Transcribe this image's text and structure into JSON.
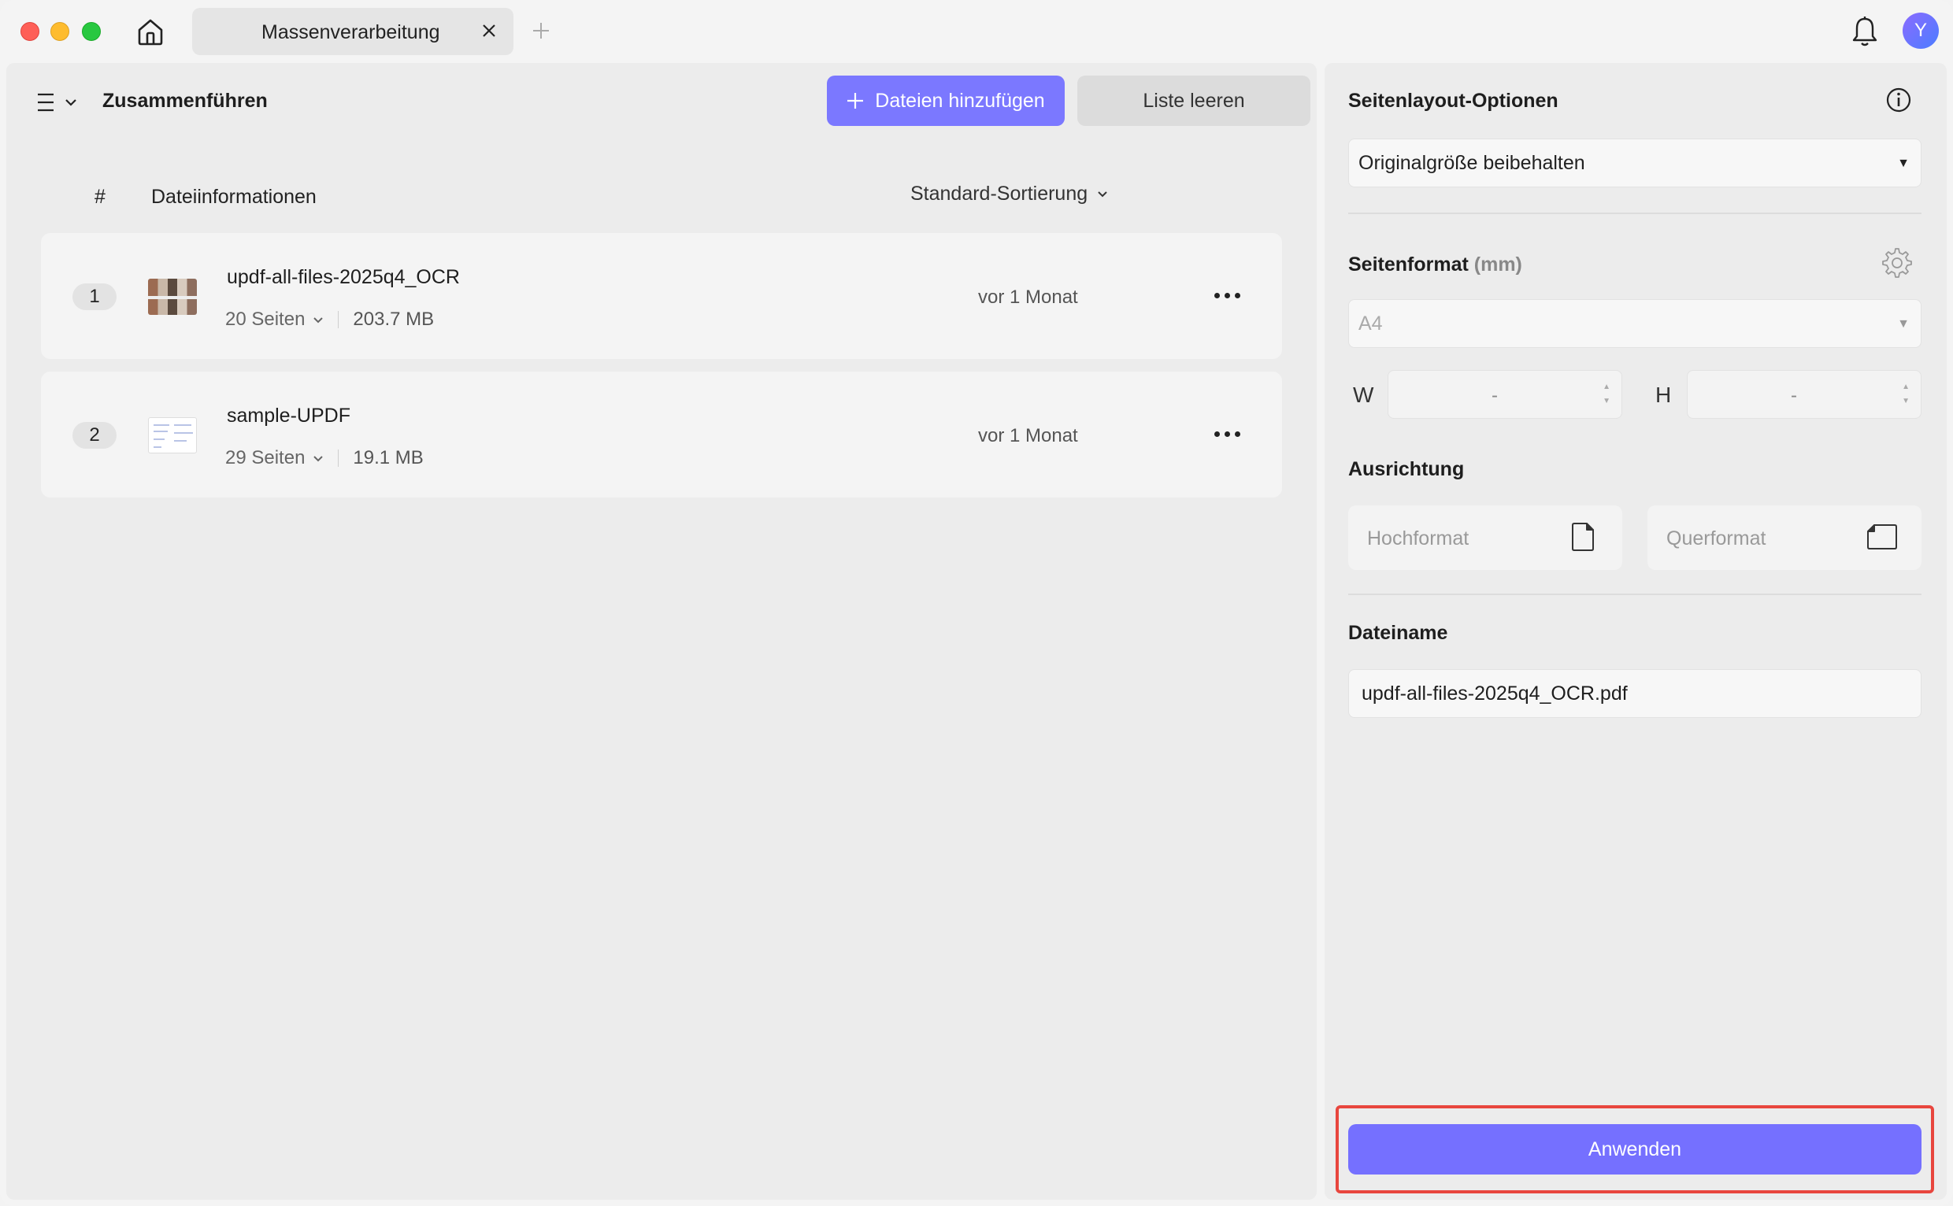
{
  "titlebar": {
    "tab_label": "Massenverarbeitung",
    "avatar_initial": "Y"
  },
  "toolbar": {
    "section_title": "Zusammenführen",
    "add_files_label": "Dateien hinzufügen",
    "clear_list_label": "Liste leeren"
  },
  "table": {
    "col_hash": "#",
    "col_info": "Dateiinformationen",
    "sort_label": "Standard-Sortierung",
    "rows": [
      {
        "num": "1",
        "name": "updf-all-files-2025q4_OCR",
        "pages": "20 Seiten",
        "size": "203.7 MB",
        "date": "vor 1 Monat"
      },
      {
        "num": "2",
        "name": "sample-UPDF",
        "pages": "29 Seiten",
        "size": "19.1 MB",
        "date": "vor 1 Monat"
      }
    ]
  },
  "options": {
    "layout_title": "Seitenlayout-Optionen",
    "layout_value": "Originalgröße beibehalten",
    "format_title": "Seitenformat",
    "format_unit": "(mm)",
    "format_value": "A4",
    "w_label": "W",
    "h_label": "H",
    "w_value": "-",
    "h_value": "-",
    "orientation_title": "Ausrichtung",
    "portrait_label": "Hochformat",
    "landscape_label": "Querformat",
    "filename_title": "Dateiname",
    "filename_value": "updf-all-files-2025q4_OCR.pdf",
    "apply_label": "Anwenden"
  },
  "colors": {
    "accent": "#7b78ff",
    "highlight_border": "#e8463e"
  }
}
